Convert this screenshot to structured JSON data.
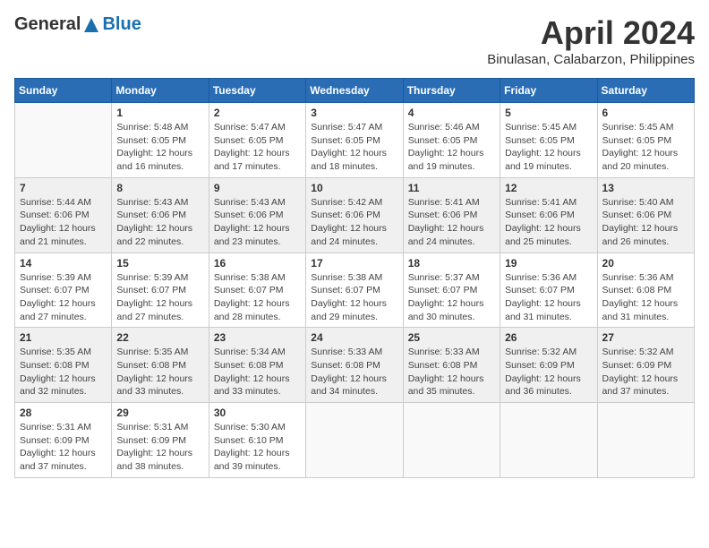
{
  "logo": {
    "general": "General",
    "blue": "Blue"
  },
  "title": "April 2024",
  "subtitle": "Binulasan, Calabarzon, Philippines",
  "days_of_week": [
    "Sunday",
    "Monday",
    "Tuesday",
    "Wednesday",
    "Thursday",
    "Friday",
    "Saturday"
  ],
  "weeks": [
    [
      {
        "day": "",
        "info": ""
      },
      {
        "day": "1",
        "info": "Sunrise: 5:48 AM\nSunset: 6:05 PM\nDaylight: 12 hours\nand 16 minutes."
      },
      {
        "day": "2",
        "info": "Sunrise: 5:47 AM\nSunset: 6:05 PM\nDaylight: 12 hours\nand 17 minutes."
      },
      {
        "day": "3",
        "info": "Sunrise: 5:47 AM\nSunset: 6:05 PM\nDaylight: 12 hours\nand 18 minutes."
      },
      {
        "day": "4",
        "info": "Sunrise: 5:46 AM\nSunset: 6:05 PM\nDaylight: 12 hours\nand 19 minutes."
      },
      {
        "day": "5",
        "info": "Sunrise: 5:45 AM\nSunset: 6:05 PM\nDaylight: 12 hours\nand 19 minutes."
      },
      {
        "day": "6",
        "info": "Sunrise: 5:45 AM\nSunset: 6:05 PM\nDaylight: 12 hours\nand 20 minutes."
      }
    ],
    [
      {
        "day": "7",
        "info": "Sunrise: 5:44 AM\nSunset: 6:06 PM\nDaylight: 12 hours\nand 21 minutes."
      },
      {
        "day": "8",
        "info": "Sunrise: 5:43 AM\nSunset: 6:06 PM\nDaylight: 12 hours\nand 22 minutes."
      },
      {
        "day": "9",
        "info": "Sunrise: 5:43 AM\nSunset: 6:06 PM\nDaylight: 12 hours\nand 23 minutes."
      },
      {
        "day": "10",
        "info": "Sunrise: 5:42 AM\nSunset: 6:06 PM\nDaylight: 12 hours\nand 24 minutes."
      },
      {
        "day": "11",
        "info": "Sunrise: 5:41 AM\nSunset: 6:06 PM\nDaylight: 12 hours\nand 24 minutes."
      },
      {
        "day": "12",
        "info": "Sunrise: 5:41 AM\nSunset: 6:06 PM\nDaylight: 12 hours\nand 25 minutes."
      },
      {
        "day": "13",
        "info": "Sunrise: 5:40 AM\nSunset: 6:06 PM\nDaylight: 12 hours\nand 26 minutes."
      }
    ],
    [
      {
        "day": "14",
        "info": "Sunrise: 5:39 AM\nSunset: 6:07 PM\nDaylight: 12 hours\nand 27 minutes."
      },
      {
        "day": "15",
        "info": "Sunrise: 5:39 AM\nSunset: 6:07 PM\nDaylight: 12 hours\nand 27 minutes."
      },
      {
        "day": "16",
        "info": "Sunrise: 5:38 AM\nSunset: 6:07 PM\nDaylight: 12 hours\nand 28 minutes."
      },
      {
        "day": "17",
        "info": "Sunrise: 5:38 AM\nSunset: 6:07 PM\nDaylight: 12 hours\nand 29 minutes."
      },
      {
        "day": "18",
        "info": "Sunrise: 5:37 AM\nSunset: 6:07 PM\nDaylight: 12 hours\nand 30 minutes."
      },
      {
        "day": "19",
        "info": "Sunrise: 5:36 AM\nSunset: 6:07 PM\nDaylight: 12 hours\nand 31 minutes."
      },
      {
        "day": "20",
        "info": "Sunrise: 5:36 AM\nSunset: 6:08 PM\nDaylight: 12 hours\nand 31 minutes."
      }
    ],
    [
      {
        "day": "21",
        "info": "Sunrise: 5:35 AM\nSunset: 6:08 PM\nDaylight: 12 hours\nand 32 minutes."
      },
      {
        "day": "22",
        "info": "Sunrise: 5:35 AM\nSunset: 6:08 PM\nDaylight: 12 hours\nand 33 minutes."
      },
      {
        "day": "23",
        "info": "Sunrise: 5:34 AM\nSunset: 6:08 PM\nDaylight: 12 hours\nand 33 minutes."
      },
      {
        "day": "24",
        "info": "Sunrise: 5:33 AM\nSunset: 6:08 PM\nDaylight: 12 hours\nand 34 minutes."
      },
      {
        "day": "25",
        "info": "Sunrise: 5:33 AM\nSunset: 6:08 PM\nDaylight: 12 hours\nand 35 minutes."
      },
      {
        "day": "26",
        "info": "Sunrise: 5:32 AM\nSunset: 6:09 PM\nDaylight: 12 hours\nand 36 minutes."
      },
      {
        "day": "27",
        "info": "Sunrise: 5:32 AM\nSunset: 6:09 PM\nDaylight: 12 hours\nand 37 minutes."
      }
    ],
    [
      {
        "day": "28",
        "info": "Sunrise: 5:31 AM\nSunset: 6:09 PM\nDaylight: 12 hours\nand 37 minutes."
      },
      {
        "day": "29",
        "info": "Sunrise: 5:31 AM\nSunset: 6:09 PM\nDaylight: 12 hours\nand 38 minutes."
      },
      {
        "day": "30",
        "info": "Sunrise: 5:30 AM\nSunset: 6:10 PM\nDaylight: 12 hours\nand 39 minutes."
      },
      {
        "day": "",
        "info": ""
      },
      {
        "day": "",
        "info": ""
      },
      {
        "day": "",
        "info": ""
      },
      {
        "day": "",
        "info": ""
      }
    ]
  ]
}
